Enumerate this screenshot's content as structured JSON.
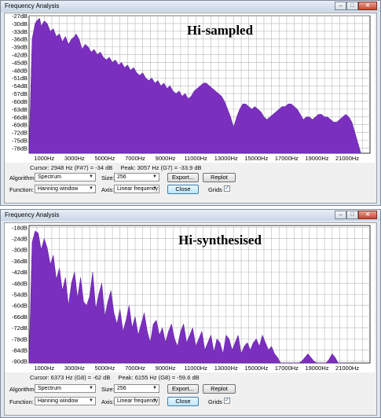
{
  "windows": [
    {
      "title": "Frequency Analysis",
      "overlay_label": "Hi-sampled",
      "status": {
        "cursor": "Cursor: 2948 Hz (F#7) = -34 dB",
        "peak": "Peak: 3057 Hz (G7) = -33.9 dB"
      },
      "controls": {
        "algorithm_label": "Algorithm:",
        "algorithm_value": "Spectrum",
        "size_label": "Size:",
        "size_value": "256",
        "function_label": "Function:",
        "function_value": "Hanning window",
        "axis_label": "Axis:",
        "axis_value": "Linear frequency",
        "export_label": "Export...",
        "replot_label": "Replot",
        "close_label": "Close",
        "grids_label": "Grids",
        "grids_checked": true
      }
    },
    {
      "title": "Frequency Analysis",
      "overlay_label": "Hi-synthesised",
      "status": {
        "cursor": "Cursor: 6373 Hz (G8) = -62 dB",
        "peak": "Peak: 6155 Hz (G8) = -59.6 dB"
      },
      "controls": {
        "algorithm_label": "Algorithm:",
        "algorithm_value": "Spectrum",
        "size_label": "Size:",
        "size_value": "256",
        "function_label": "Function:",
        "function_value": "Hanning window",
        "axis_label": "Axis:",
        "axis_value": "Linear frequency",
        "export_label": "Export...",
        "replot_label": "Replot",
        "close_label": "Close",
        "grids_label": "Grids",
        "grids_checked": true
      }
    }
  ],
  "chart_data": [
    {
      "type": "area",
      "color": "#7b2fbf",
      "grid": true,
      "xlim": [
        0,
        22500
      ],
      "ylim": [
        -80,
        -27
      ],
      "x_ticks": [
        1000,
        3000,
        5000,
        7000,
        9000,
        11000,
        13000,
        15000,
        17000,
        19000,
        21000
      ],
      "x_tick_labels": [
        "1000Hz",
        "3000Hz",
        "5000Hz",
        "7000Hz",
        "9000Hz",
        "11000Hz",
        "13000Hz",
        "15000Hz",
        "17000Hz",
        "19000Hz",
        "21000Hz"
      ],
      "y_ticks": [
        -27,
        -30,
        -33,
        -36,
        -39,
        -42,
        -45,
        -48,
        -51,
        -54,
        -57,
        -60,
        -63,
        -66,
        -69,
        -72,
        -75,
        -78
      ],
      "y_tick_labels": [
        "-27dB",
        "-30dB",
        "-33dB",
        "-36dB",
        "-39dB",
        "-42dB",
        "-45dB",
        "-48dB",
        "-51dB",
        "-54dB",
        "-57dB",
        "-60dB",
        "-63dB",
        "-66dB",
        "-69dB",
        "-72dB",
        "-75dB",
        "-78dB"
      ],
      "x": [
        0,
        200,
        400,
        500,
        700,
        800,
        1000,
        1200,
        1400,
        1600,
        1800,
        2000,
        2200,
        2400,
        2600,
        2800,
        3000,
        3100,
        3300,
        3500,
        3700,
        3900,
        4100,
        4300,
        4500,
        4700,
        4900,
        5100,
        5300,
        5500,
        5700,
        5900,
        6100,
        6300,
        6500,
        6700,
        6900,
        7100,
        7300,
        7500,
        7700,
        7900,
        8100,
        8300,
        8500,
        8700,
        8900,
        9100,
        9300,
        9500,
        9700,
        9900,
        10100,
        10300,
        10500,
        10700,
        10900,
        11100,
        11300,
        11500,
        11700,
        11900,
        12100,
        12300,
        12500,
        12700,
        12900,
        13100,
        13300,
        13500,
        13700,
        13900,
        14100,
        14300,
        14500,
        14700,
        14900,
        15100,
        15300,
        15500,
        15700,
        15900,
        16100,
        16300,
        16500,
        16700,
        16900,
        17100,
        17300,
        17500,
        17700,
        17900,
        18100,
        18300,
        18500,
        18700,
        18900,
        19100,
        19300,
        19500,
        19700,
        19900,
        20100,
        20300,
        20500,
        20700,
        20900,
        21100,
        21300,
        21500,
        21700,
        21900
      ],
      "y": [
        -80,
        -36,
        -30,
        -29,
        -28,
        -31,
        -29,
        -30,
        -33,
        -32,
        -35,
        -34,
        -37,
        -35,
        -38,
        -36,
        -35,
        -34,
        -36,
        -40,
        -38,
        -39,
        -41,
        -40,
        -42,
        -41,
        -43,
        -44,
        -43,
        -45,
        -44,
        -46,
        -45,
        -47,
        -46,
        -48,
        -47,
        -49,
        -50,
        -49,
        -51,
        -52,
        -51,
        -53,
        -52,
        -54,
        -53,
        -55,
        -54,
        -56,
        -57,
        -56,
        -58,
        -57,
        -59,
        -58,
        -56,
        -55,
        -54,
        -53,
        -53,
        -54,
        -55,
        -56,
        -57,
        -58,
        -60,
        -63,
        -66,
        -70,
        -66,
        -63,
        -61,
        -61,
        -62,
        -63,
        -62,
        -63,
        -64,
        -66,
        -67,
        -66,
        -65,
        -64,
        -63,
        -62,
        -62,
        -61,
        -61,
        -62,
        -63,
        -65,
        -67,
        -66,
        -66,
        -67,
        -66,
        -65,
        -65,
        -66,
        -66,
        -67,
        -68,
        -68,
        -67,
        -66,
        -65,
        -66,
        -68,
        -72,
        -76,
        -80
      ]
    },
    {
      "type": "area",
      "color": "#7b2fbf",
      "grid": true,
      "xlim": [
        0,
        22500
      ],
      "ylim": [
        -91,
        -17
      ],
      "x_ticks": [
        1000,
        3000,
        5000,
        7000,
        9000,
        11000,
        13000,
        15000,
        17000,
        19000,
        21000
      ],
      "x_tick_labels": [
        "1000Hz",
        "3000Hz",
        "5000Hz",
        "7000Hz",
        "9000Hz",
        "11000Hz",
        "13000Hz",
        "15000Hz",
        "17000Hz",
        "19000Hz",
        "21000Hz"
      ],
      "y_ticks": [
        -18,
        -24,
        -30,
        -36,
        -42,
        -48,
        -54,
        -60,
        -66,
        -72,
        -78,
        -84,
        -90
      ],
      "y_tick_labels": [
        "-18dB",
        "-24dB",
        "-30dB",
        "-36dB",
        "-42dB",
        "-48dB",
        "-54dB",
        "-60dB",
        "-66dB",
        "-72dB",
        "-78dB",
        "-84dB",
        "-90dB"
      ],
      "x": [
        0,
        200,
        400,
        600,
        800,
        1000,
        1200,
        1400,
        1600,
        1800,
        2000,
        2200,
        2400,
        2600,
        2800,
        3000,
        3200,
        3400,
        3600,
        3800,
        4000,
        4200,
        4400,
        4600,
        4800,
        5000,
        5200,
        5400,
        5600,
        5800,
        6000,
        6200,
        6400,
        6600,
        6800,
        7000,
        7200,
        7400,
        7600,
        7800,
        8000,
        8200,
        8400,
        8600,
        8800,
        9000,
        9200,
        9400,
        9600,
        9800,
        10000,
        10200,
        10400,
        10600,
        10800,
        11000,
        11200,
        11400,
        11600,
        11800,
        12000,
        12200,
        12400,
        12600,
        12800,
        13000,
        13200,
        13400,
        13600,
        13800,
        14000,
        14200,
        14400,
        14600,
        14800,
        15000,
        15200,
        15400,
        15600,
        15800,
        16000,
        16200,
        16400,
        16600,
        16800,
        17000,
        17200,
        17400,
        17600,
        17800,
        18000,
        18200,
        18400,
        18600,
        18800,
        19000,
        19200,
        19400,
        19600,
        19800,
        20000,
        20200,
        20400,
        20600,
        20800,
        21000
      ],
      "y": [
        -91,
        -26,
        -20,
        -21,
        -30,
        -24,
        -29,
        -38,
        -33,
        -46,
        -40,
        -52,
        -45,
        -60,
        -48,
        -42,
        -56,
        -45,
        -58,
        -60,
        -55,
        -42,
        -62,
        -54,
        -48,
        -66,
        -58,
        -52,
        -64,
        -70,
        -62,
        -74,
        -68,
        -60,
        -72,
        -66,
        -76,
        -70,
        -64,
        -74,
        -80,
        -70,
        -68,
        -76,
        -72,
        -80,
        -74,
        -70,
        -78,
        -82,
        -74,
        -70,
        -80,
        -76,
        -72,
        -82,
        -78,
        -74,
        -84,
        -80,
        -76,
        -85,
        -78,
        -80,
        -86,
        -76,
        -78,
        -84,
        -80,
        -76,
        -86,
        -82,
        -80,
        -84,
        -80,
        -78,
        -82,
        -76,
        -80,
        -84,
        -82,
        -86,
        -88,
        -91,
        -91,
        -91,
        -91,
        -91,
        -91,
        -91,
        -90,
        -88,
        -86,
        -88,
        -90,
        -91,
        -91,
        -91,
        -91,
        -89,
        -86,
        -88,
        -91,
        -91,
        -91,
        -91
      ]
    }
  ]
}
